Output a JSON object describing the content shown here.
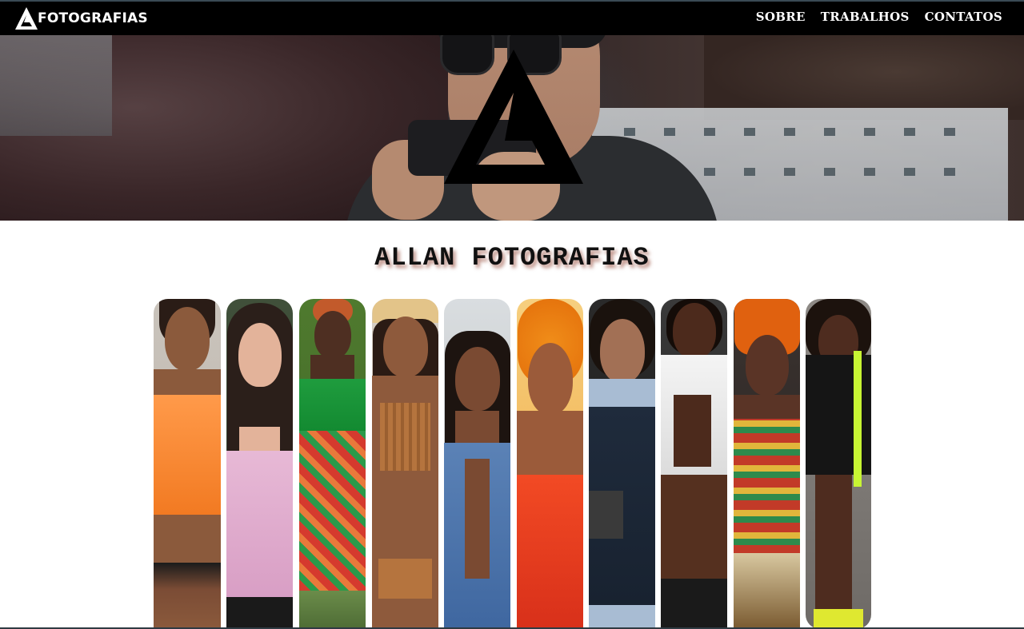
{
  "nav": {
    "brand": "FOTOGRAFIAS",
    "links": [
      "SOBRE",
      "TRABALHOS",
      "CONTATOS"
    ]
  },
  "main": {
    "title": "ALLAN FOTOGRAFIAS"
  },
  "gallery": {
    "photos": [
      {
        "name": "portrait-orange-top"
      },
      {
        "name": "portrait-pink-blouse"
      },
      {
        "name": "portrait-green-top"
      },
      {
        "name": "portrait-straw-hat"
      },
      {
        "name": "portrait-braids-denim"
      },
      {
        "name": "portrait-orange-hair"
      },
      {
        "name": "portrait-glasses-uniform"
      },
      {
        "name": "portrait-white-shirt"
      },
      {
        "name": "portrait-headwrap"
      },
      {
        "name": "portrait-tracksuit"
      }
    ]
  },
  "colors": {
    "nav_bg": "#000000",
    "nav_text": "#ffffff",
    "title_text": "#111111",
    "title_shadow": "#822814"
  }
}
